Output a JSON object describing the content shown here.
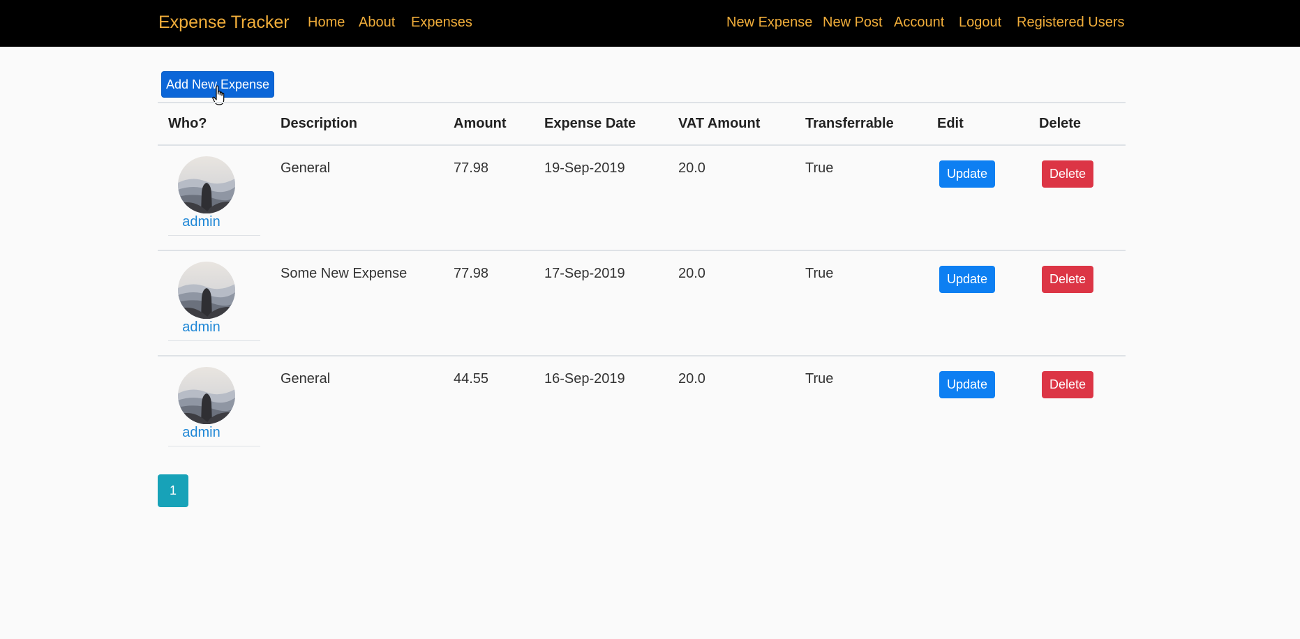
{
  "navbar": {
    "brand": "Expense Tracker",
    "left_links": [
      "Home",
      "About",
      "Expenses"
    ],
    "right_links": [
      "New Expense",
      "New Post",
      "Account",
      "Logout",
      "Registered Users"
    ]
  },
  "toolbar": {
    "add_label": "Add New Expense"
  },
  "table": {
    "headers": [
      "Who?",
      "Description",
      "Amount",
      "Expense Date",
      "VAT Amount",
      "Transferrable",
      "Edit",
      "Delete"
    ],
    "rows": [
      {
        "user": "admin",
        "description": "General",
        "amount": "77.98",
        "date": "19-Sep-2019",
        "vat": "20.0",
        "transferrable": "True",
        "update_label": "Update",
        "delete_label": "Delete"
      },
      {
        "user": "admin",
        "description": "Some New Expense",
        "amount": "77.98",
        "date": "17-Sep-2019",
        "vat": "20.0",
        "transferrable": "True",
        "update_label": "Update",
        "delete_label": "Delete"
      },
      {
        "user": "admin",
        "description": "General",
        "amount": "44.55",
        "date": "16-Sep-2019",
        "vat": "20.0",
        "transferrable": "True",
        "update_label": "Update",
        "delete_label": "Delete"
      }
    ]
  },
  "pagination": {
    "current": "1"
  },
  "colors": {
    "navbar_bg": "#000000",
    "nav_link": "#f0ad3a",
    "primary": "#0d7ff2",
    "danger": "#dc3545",
    "info": "#17a2b8",
    "username_link": "#1f87d6"
  },
  "icons": {
    "avatar": "hooded-figure-mountains-avatar",
    "cursor": "hand-pointer-cursor-icon"
  }
}
